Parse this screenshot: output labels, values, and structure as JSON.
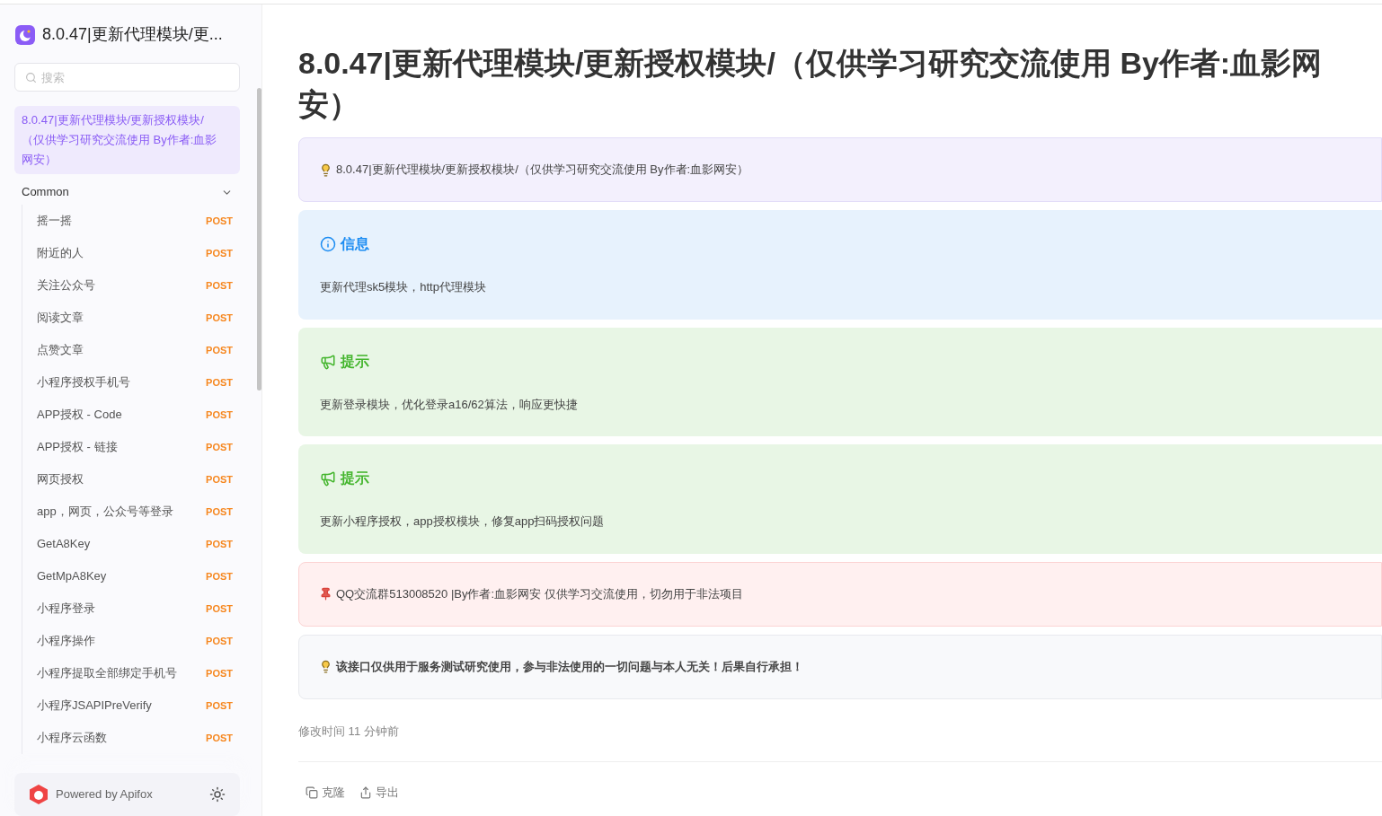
{
  "sidebar": {
    "project_title": "8.0.47|更新代理模块/更...",
    "search": {
      "placeholder": "搜索"
    },
    "doc_item": {
      "label": "8.0.47|更新代理模块/更新授权模块/（仅供学习研究交流使用 By作者:血影网安）",
      "selected": true
    },
    "group": {
      "label": "Common",
      "expanded": true,
      "items": [
        {
          "name": "摇一摇",
          "method": "POST",
          "selected": false
        },
        {
          "name": "附近的人",
          "method": "POST",
          "selected": false
        },
        {
          "name": "关注公众号",
          "method": "POST",
          "selected": false
        },
        {
          "name": "阅读文章",
          "method": "POST",
          "selected": false
        },
        {
          "name": "点赞文章",
          "method": "POST",
          "selected": false
        },
        {
          "name": "小程序授权手机号",
          "method": "POST",
          "selected": false
        },
        {
          "name": "APP授权 - Code",
          "method": "POST",
          "selected": false
        },
        {
          "name": "APP授权 - 链接",
          "method": "POST",
          "selected": false
        },
        {
          "name": "网页授权",
          "method": "POST",
          "selected": false
        },
        {
          "name": "app，网页，公众号等登录",
          "method": "POST",
          "selected": false
        },
        {
          "name": "GetA8Key",
          "method": "POST",
          "selected": false
        },
        {
          "name": "GetMpA8Key",
          "method": "POST",
          "selected": false
        },
        {
          "name": "小程序登录",
          "method": "POST",
          "selected": false
        },
        {
          "name": "小程序操作",
          "method": "POST",
          "selected": false
        },
        {
          "name": "小程序提取全部绑定手机号",
          "method": "POST",
          "selected": false
        },
        {
          "name": "小程序JSAPIPreVerify",
          "method": "POST",
          "selected": false
        },
        {
          "name": "小程序云函数",
          "method": "POST",
          "selected": false
        }
      ]
    },
    "footer": {
      "label": "Powered by Apifox"
    }
  },
  "page": {
    "title": "8.0.47|更新代理模块/更新授权模块/（仅供学习研究交流使用 By作者:血影网安）",
    "callouts": [
      {
        "kind": "note",
        "text": "8.0.47|更新代理模块/更新授权模块/（仅供学习研究交流使用 By作者:血影网安）"
      },
      {
        "kind": "info",
        "title": "信息",
        "text": "更新代理sk5模块，http代理模块"
      },
      {
        "kind": "tip",
        "title": "提示",
        "text": "更新登录模块，优化登录a16/62算法，响应更快捷"
      },
      {
        "kind": "tip",
        "title": "提示",
        "text": "更新小程序授权，app授权模块，修复app扫码授权问题"
      },
      {
        "kind": "danger",
        "text": "QQ交流群513008520 |By作者:血影网安 仅供学习交流使用，切勿用于非法项目"
      },
      {
        "kind": "warning",
        "text": "该接口仅供用于服务测试研究使用，参与非法使用的一切问题与本人无关！后果自行承担！"
      }
    ],
    "modified": "修改时间 11 分钟前",
    "actions": [
      {
        "kind": "clone",
        "label": "克隆"
      },
      {
        "kind": "export",
        "label": "导出"
      }
    ]
  }
}
